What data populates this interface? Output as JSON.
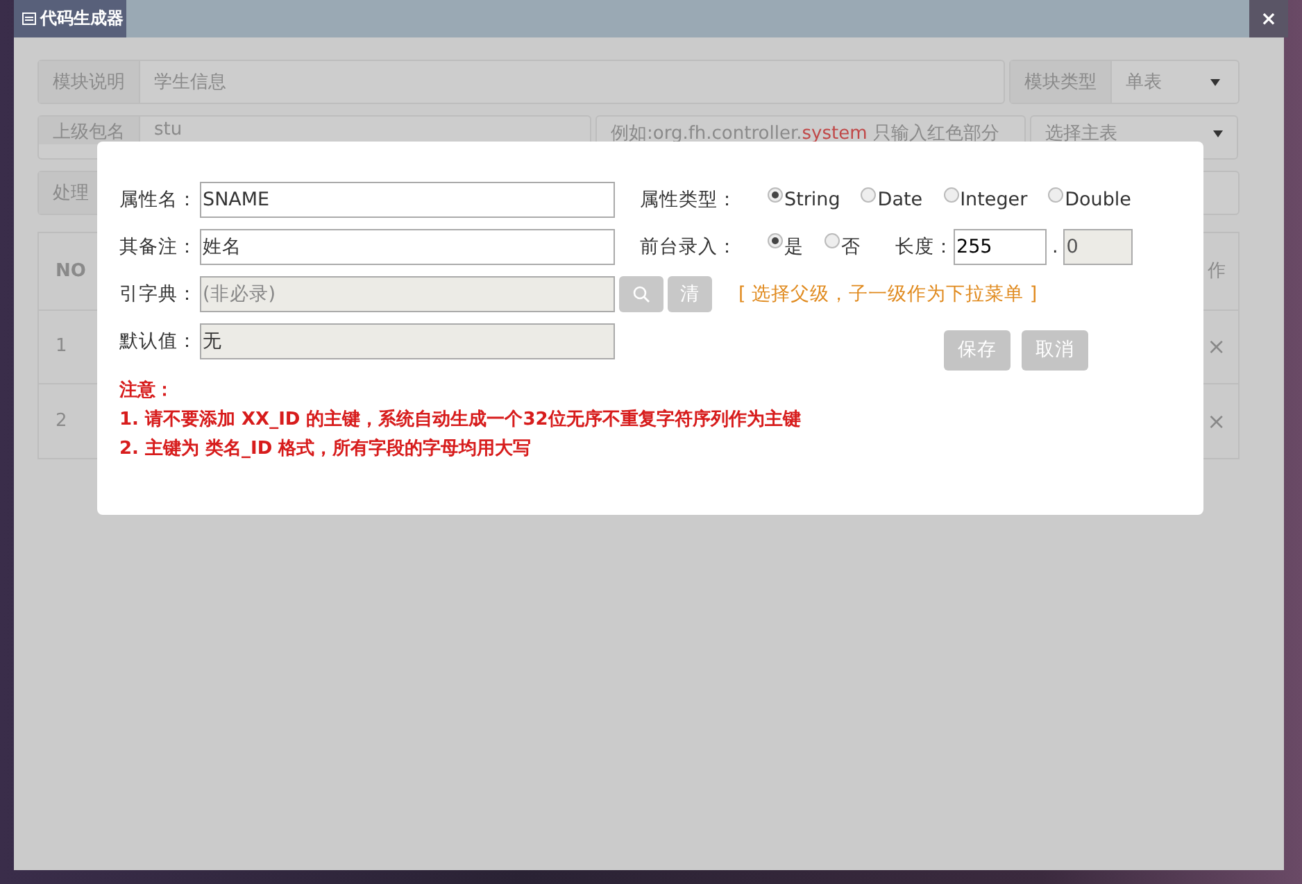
{
  "window": {
    "title": "代码生成器",
    "close": "×"
  },
  "form": {
    "module_description": {
      "label": "模块说明",
      "value": "学生信息"
    },
    "module_type": {
      "label": "模块类型",
      "value": "单表"
    },
    "parent_package": {
      "label": "上级包名",
      "value": "stu"
    },
    "package_hint": {
      "before": "例如:org.fh.controller.",
      "highlight": "system",
      "after": " 只输入红色部分"
    },
    "main_table": {
      "placeholder": "选择主表"
    },
    "handler": {
      "label": "处理"
    }
  },
  "table": {
    "columns": [
      "NO",
      "作"
    ],
    "rows": [
      {
        "no": "1",
        "action": "×"
      },
      {
        "no": "2",
        "action": "×"
      }
    ]
  },
  "dialog": {
    "attribute_name": {
      "label": "属性名：",
      "value": "SNAME"
    },
    "attribute_type": {
      "label": "属性类型：",
      "options": [
        {
          "label": "String",
          "selected": true
        },
        {
          "label": "Date",
          "selected": false
        },
        {
          "label": "Integer",
          "selected": false
        },
        {
          "label": "Double",
          "selected": false
        }
      ]
    },
    "remark": {
      "label": "其备注：",
      "value": "姓名"
    },
    "frontend_input": {
      "label": "前台录入：",
      "options": [
        {
          "label": "是",
          "selected": true
        },
        {
          "label": "否",
          "selected": false
        }
      ]
    },
    "length": {
      "label": "长度：",
      "value": "255",
      "separator": ".",
      "precision": "0"
    },
    "dictionary": {
      "label": "引字典：",
      "placeholder": "(非必录)",
      "clear_button": "清",
      "hint": "[ 选择父级，子一级作为下拉菜单 ]"
    },
    "default_value": {
      "label": "默认值：",
      "value": "无"
    },
    "buttons": [
      "保存",
      "取消"
    ],
    "notes": [
      "注意：",
      "1. 请不要添加 XX_ID 的主键，系统自动生成一个32位无序不重复字符序列作为主键",
      "2. 主键为 类名_ID 格式，所有字段的字母均用大写"
    ]
  }
}
